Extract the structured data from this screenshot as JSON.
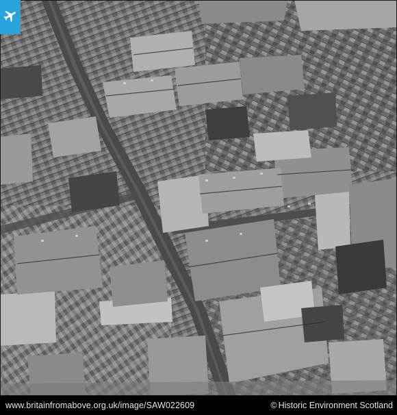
{
  "logo": {
    "icon": "airplane-icon",
    "color": "#2aa3dc"
  },
  "photo": {
    "icon": "aerial-photo",
    "style": "black-and-white"
  },
  "footer": {
    "url": "www.britainfromabove.org.uk/image/SAW022609",
    "copyright_symbol": "©",
    "credit": "Historic Environment Scotland"
  }
}
